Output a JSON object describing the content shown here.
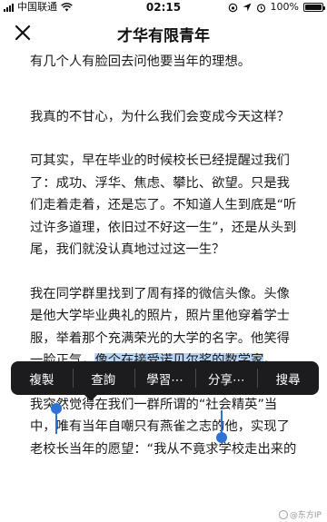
{
  "status_bar": {
    "carrier": "中国联通",
    "time": "02:15",
    "battery_text": "100%",
    "battery_level": 1.0
  },
  "nav": {
    "title": "才华有限青年",
    "close_icon": "close-icon"
  },
  "article": {
    "paragraphs": [
      {
        "segments": [
          {
            "text": "有几个人有脸回去问他要当年的理想。"
          }
        ]
      },
      {
        "segments": [
          {
            "text": "我真的不甘心，为什么我们会变成今天这样？"
          }
        ]
      },
      {
        "segments": [
          {
            "text": "可其实，早在毕业的时候校长已经提醒过我们了：成功、浮华、焦虑、攀比、欲望。只是我们走着走着，还是忘了。不知道人生到底是“听过许多道理，依旧过不好这一生”，还是从头到尾，我们就没认真地过过这一生？"
          }
        ]
      },
      {
        "segments": [
          {
            "text": "我在同学群里找到了周有择的微信头像。头像是他大学毕业典礼的照片，照片里他穿着学士服，举着那个充满荣光的大学的名字。他笑得一脸正气，"
          },
          {
            "text": "像个在接受诺贝尔奖的数学家",
            "selected": true
          },
          {
            "text": "。"
          }
        ]
      },
      {
        "segments": [
          {
            "text": "我突然觉得在我们一群所谓的“社会精英”当中，唯有当年自嘲只有燕雀之志的他，实现了老校长当年的愿望：“我从不竟求学校走出来的"
          }
        ]
      }
    ]
  },
  "context_menu": {
    "items": [
      "複製",
      "查詢",
      "學習⋯",
      "分享⋯",
      "搜尋"
    ]
  },
  "watermark": {
    "text": "@东方IP"
  },
  "colors": {
    "selection": "#b9d6f4",
    "handle": "#2f72d6",
    "menu_bg": "#1c1c1e"
  }
}
